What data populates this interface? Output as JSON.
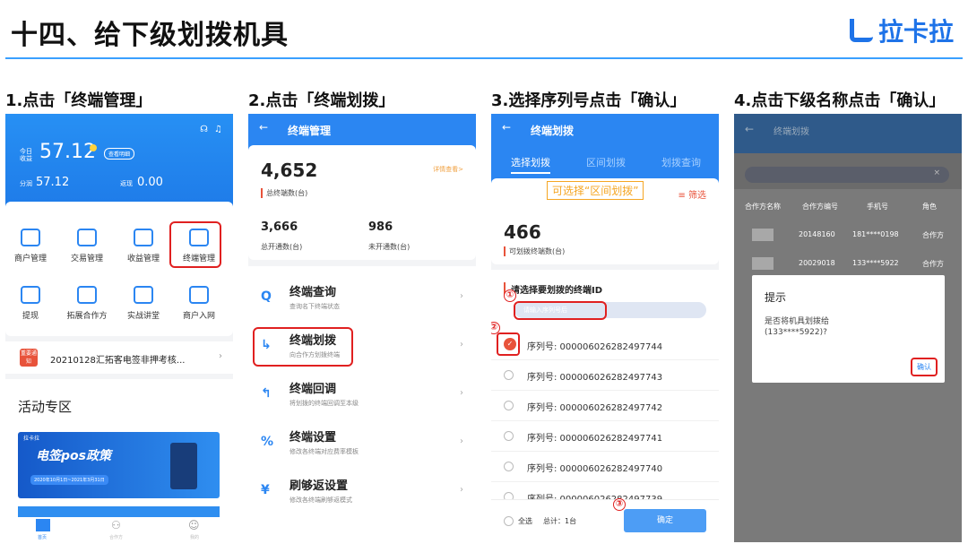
{
  "header": {
    "title": "十四、给下级划拨机具",
    "brand": "拉卡拉"
  },
  "steps": [
    "1.点击「终端管理」",
    "2.点击「终端划拨」",
    "3.选择序列号点击「确认」",
    "4.点击下级名称点击「确认」"
  ],
  "panel1": {
    "today_label1": "今日",
    "today_label2": "收益",
    "amount": "57.12",
    "detail_btn": "查看明细",
    "stat1_label": "分润",
    "stat1_value": "57.12",
    "stat2_label": "返现",
    "stat2_value": "0.00",
    "grid": [
      "商户管理",
      "交易管理",
      "收益管理",
      "终端管理",
      "提现",
      "拓展合作方",
      "实战讲堂",
      "商户入网"
    ],
    "notice_badge": "重要通知",
    "notice_text": "20210128汇拓客电签非押考核...",
    "section": "活动专区",
    "banner_brand": "拉卡拉",
    "banner_title": "电签pos政策",
    "banner_date": "2020年10月1日~2021年3月31日",
    "tabs": [
      "首页",
      "合作方",
      "我的"
    ]
  },
  "panel2": {
    "nav_title": "终端管理",
    "total": "4,652",
    "detail_link": "详情查看>",
    "total_label": "总终端数(台)",
    "open_value": "3,666",
    "open_label": "总开通数(台)",
    "unopen_value": "986",
    "unopen_label": "未开通数(台)",
    "menu": [
      {
        "title": "终端查询",
        "sub": "查询名下终端状态"
      },
      {
        "title": "终端划拨",
        "sub": "向合作方划拨终端"
      },
      {
        "title": "终端回调",
        "sub": "将划拨的终端回调至本级"
      },
      {
        "title": "终端设置",
        "sub": "修改各终端对应费率模板"
      },
      {
        "title": "刷够返设置",
        "sub": "修改各终端刷够返模式"
      }
    ]
  },
  "panel3": {
    "nav_title": "终端划拨",
    "tabs": [
      "选择划拨",
      "区间划拨",
      "划拨查询"
    ],
    "annotation": "可选择“区间划拨”",
    "filter": "筛选",
    "count": "466",
    "count_label": "可划拨终端数(台)",
    "select_label": "请选择要划拨的终端ID",
    "search_placeholder": "请输入序列号后",
    "serials": [
      "序列号: 000006026282497744",
      "序列号: 000006026282497743",
      "序列号: 000006026282497742",
      "序列号: 000006026282497741",
      "序列号: 000006026282497740",
      "序列号: 000006026282497739"
    ],
    "select_all": "全选",
    "total": "总计：1台",
    "confirm": "确定",
    "markers": [
      "①",
      "②",
      "③"
    ]
  },
  "panel4": {
    "nav_title": "终端划拨",
    "columns": [
      "合作方名称",
      "合作方编号",
      "手机号",
      "角色"
    ],
    "rows": [
      {
        "id": "20148160",
        "phone": "181****0198",
        "role": "合作方"
      },
      {
        "id": "20029018",
        "phone": "133****5922",
        "role": "合作方"
      }
    ],
    "dialog_title": "提示",
    "dialog_text": "是否将机具划拨给(133****5922)?",
    "dialog_confirm": "确认"
  }
}
